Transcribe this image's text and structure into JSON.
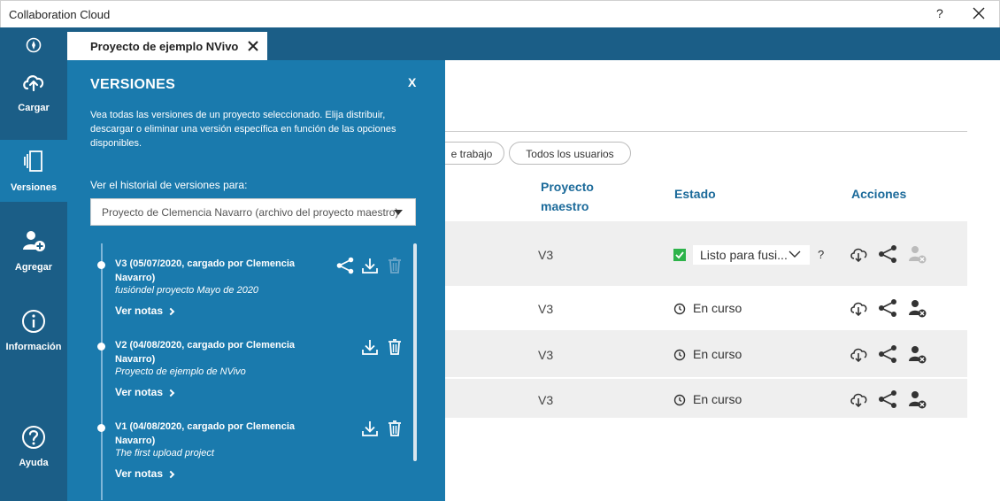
{
  "window": {
    "title": "Collaboration Cloud",
    "help": "?"
  },
  "tab": {
    "label": "Proyecto de ejemplo NVivo"
  },
  "sidebar": {
    "items": [
      {
        "label": "Cargar",
        "icon": "cloud-upload-icon"
      },
      {
        "label": "Versiones",
        "icon": "versions-icon",
        "active": true
      },
      {
        "label": "Agregar",
        "icon": "add-user-icon"
      },
      {
        "label": "Información",
        "icon": "info-icon"
      },
      {
        "label": "Ayuda",
        "icon": "help-icon"
      }
    ]
  },
  "panel": {
    "title": "VERSIONES",
    "close": "X",
    "description": "Vea todas las versiones de un proyecto seleccionado. Elija distribuir, descargar o eliminar una versión específica en función de las opciones disponibles.",
    "history_label": "Ver el historial de versiones para:",
    "select_value": "Proyecto de Clemencia Navarro (archivo del proyecto maestro)",
    "versions": [
      {
        "title": "V3 (05/07/2020, cargado por Clemencia Navarro)",
        "desc": "fusióndel proyecto Mayo de 2020",
        "notes": "Ver notas"
      },
      {
        "title": "V2 (04/08/2020, cargado por Clemencia Navarro)",
        "desc": "Proyecto de ejemplo de NVivo",
        "notes": "Ver notas"
      },
      {
        "title": "V1 (04/08/2020, cargado por Clemencia Navarro)",
        "desc": "The first upload project",
        "notes": "Ver notas"
      }
    ]
  },
  "filters": {
    "pill1": "e trabajo",
    "pill2": "Todos los usuarios"
  },
  "table": {
    "headers": {
      "master_line1": "Proyecto",
      "master_line2": "maestro",
      "status": "Estado",
      "actions": "Acciones"
    },
    "rows": [
      {
        "version": "V3",
        "status": "Listo para fusi...",
        "status_help": "?"
      },
      {
        "version": "V3",
        "status": "En curso"
      },
      {
        "version": "V3",
        "status": "En curso"
      },
      {
        "version": "V3",
        "status": "En curso"
      }
    ]
  },
  "colors": {
    "brand": "#1b5e87",
    "panel": "#1a7aad",
    "accent_text": "#1b6a9a",
    "ready_green": "#2db34a"
  }
}
